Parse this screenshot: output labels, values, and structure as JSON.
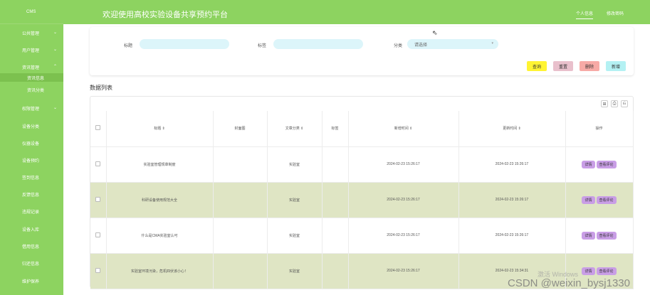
{
  "sidebar": {
    "logo": "CMS",
    "menu": [
      {
        "label": "公共管理",
        "caret": "⌄"
      },
      {
        "label": "用户管理",
        "caret": "⌄"
      },
      {
        "label": "资讯管理",
        "caret": "⌃"
      },
      {
        "label": "权限管理",
        "caret": "⌄"
      },
      {
        "label": "设备分类",
        "caret": ""
      },
      {
        "label": "仪器设备",
        "caret": ""
      },
      {
        "label": "设备预约",
        "caret": ""
      },
      {
        "label": "签到信息",
        "caret": ""
      },
      {
        "label": "反馈信息",
        "caret": ""
      },
      {
        "label": "违规记录",
        "caret": ""
      },
      {
        "label": "设备入库",
        "caret": ""
      },
      {
        "label": "借用信息",
        "caret": ""
      },
      {
        "label": "归还信息",
        "caret": ""
      },
      {
        "label": "维护保养",
        "caret": ""
      }
    ],
    "submenu": [
      {
        "label": "资讯信息",
        "active": true
      },
      {
        "label": "资讯分类",
        "active": false
      }
    ]
  },
  "header": {
    "title": "欢迎使用高校实验设备共享预约平台",
    "links": [
      "个人信息",
      "修改密码"
    ]
  },
  "search": {
    "title_label": "标题",
    "title_value": "",
    "tag_label": "标签",
    "tag_value": "",
    "category_label": "分类",
    "category_value": "请选择",
    "buttons": {
      "query": "查询",
      "reset": "重置",
      "delete": "删除",
      "add": "新增"
    }
  },
  "list_title": "数据列表",
  "toolbar_icons": [
    "⊞",
    "⎙",
    "⎌"
  ],
  "table": {
    "headers": [
      "标题 ⇕",
      "封面图",
      "文章分类 ⇕",
      "标签",
      "新增时间 ⇕",
      "更新时间 ⇕",
      "操作"
    ],
    "rows": [
      {
        "title": "实验室管理规章制度",
        "cover": "",
        "category": "实验室",
        "tag": "",
        "created": "2024-02-23 15:26:17",
        "updated": "2024-02-23 15:26:17",
        "actions": [
          "详情",
          "查看评论"
        ]
      },
      {
        "title": "科研设备使用规范大全",
        "cover": "",
        "category": "实验室",
        "tag": "",
        "created": "2024-02-23 15:26:17",
        "updated": "2024-02-23 15:26:17",
        "actions": [
          "详情",
          "查看评论"
        ]
      },
      {
        "title": "什么是CMA实验室认可",
        "cover": "",
        "category": "实验室",
        "tag": "",
        "created": "2024-02-23 15:26:17",
        "updated": "2024-02-23 15:26:17",
        "actions": [
          "详情",
          "查看评论"
        ]
      },
      {
        "title": "实验室环境污染，危机四伏该小心！",
        "cover": "",
        "category": "实验室",
        "tag": "",
        "created": "2024-02-23 15:26:17",
        "updated": "2024-02-23 15:34:31",
        "actions": [
          "详情",
          "查看评论"
        ]
      }
    ]
  },
  "watermark": {
    "activate": "激活 Windows",
    "csdn": "CSDN @weixin_bysj1330"
  }
}
